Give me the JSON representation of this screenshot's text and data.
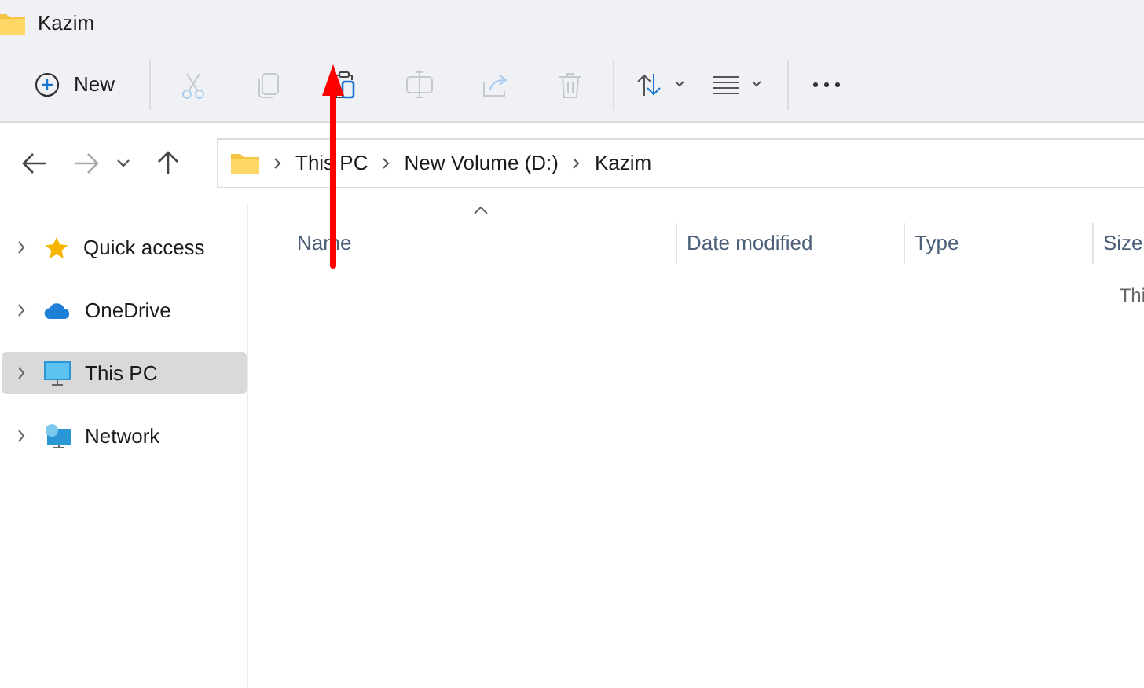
{
  "window": {
    "title": "Kazim"
  },
  "toolbar": {
    "new_label": "New",
    "buttons": [
      {
        "kind": "cut",
        "disabled": true
      },
      {
        "kind": "copy",
        "disabled": true
      },
      {
        "kind": "paste",
        "disabled": false
      },
      {
        "kind": "rename",
        "disabled": true
      },
      {
        "kind": "share",
        "disabled": true
      },
      {
        "kind": "delete",
        "disabled": true
      }
    ]
  },
  "breadcrumb": [
    "This PC",
    "New Volume (D:)",
    "Kazim"
  ],
  "sidebar": {
    "items": [
      {
        "kind": "star",
        "label": "Quick access",
        "selected": false
      },
      {
        "kind": "cloud",
        "label": "OneDrive",
        "selected": false
      },
      {
        "kind": "pc",
        "label": "This PC",
        "selected": true
      },
      {
        "kind": "network",
        "label": "Network",
        "selected": false
      }
    ]
  },
  "table": {
    "columns": [
      "Name",
      "Date modified",
      "Type",
      "Size"
    ],
    "empty_message": "Thi"
  }
}
